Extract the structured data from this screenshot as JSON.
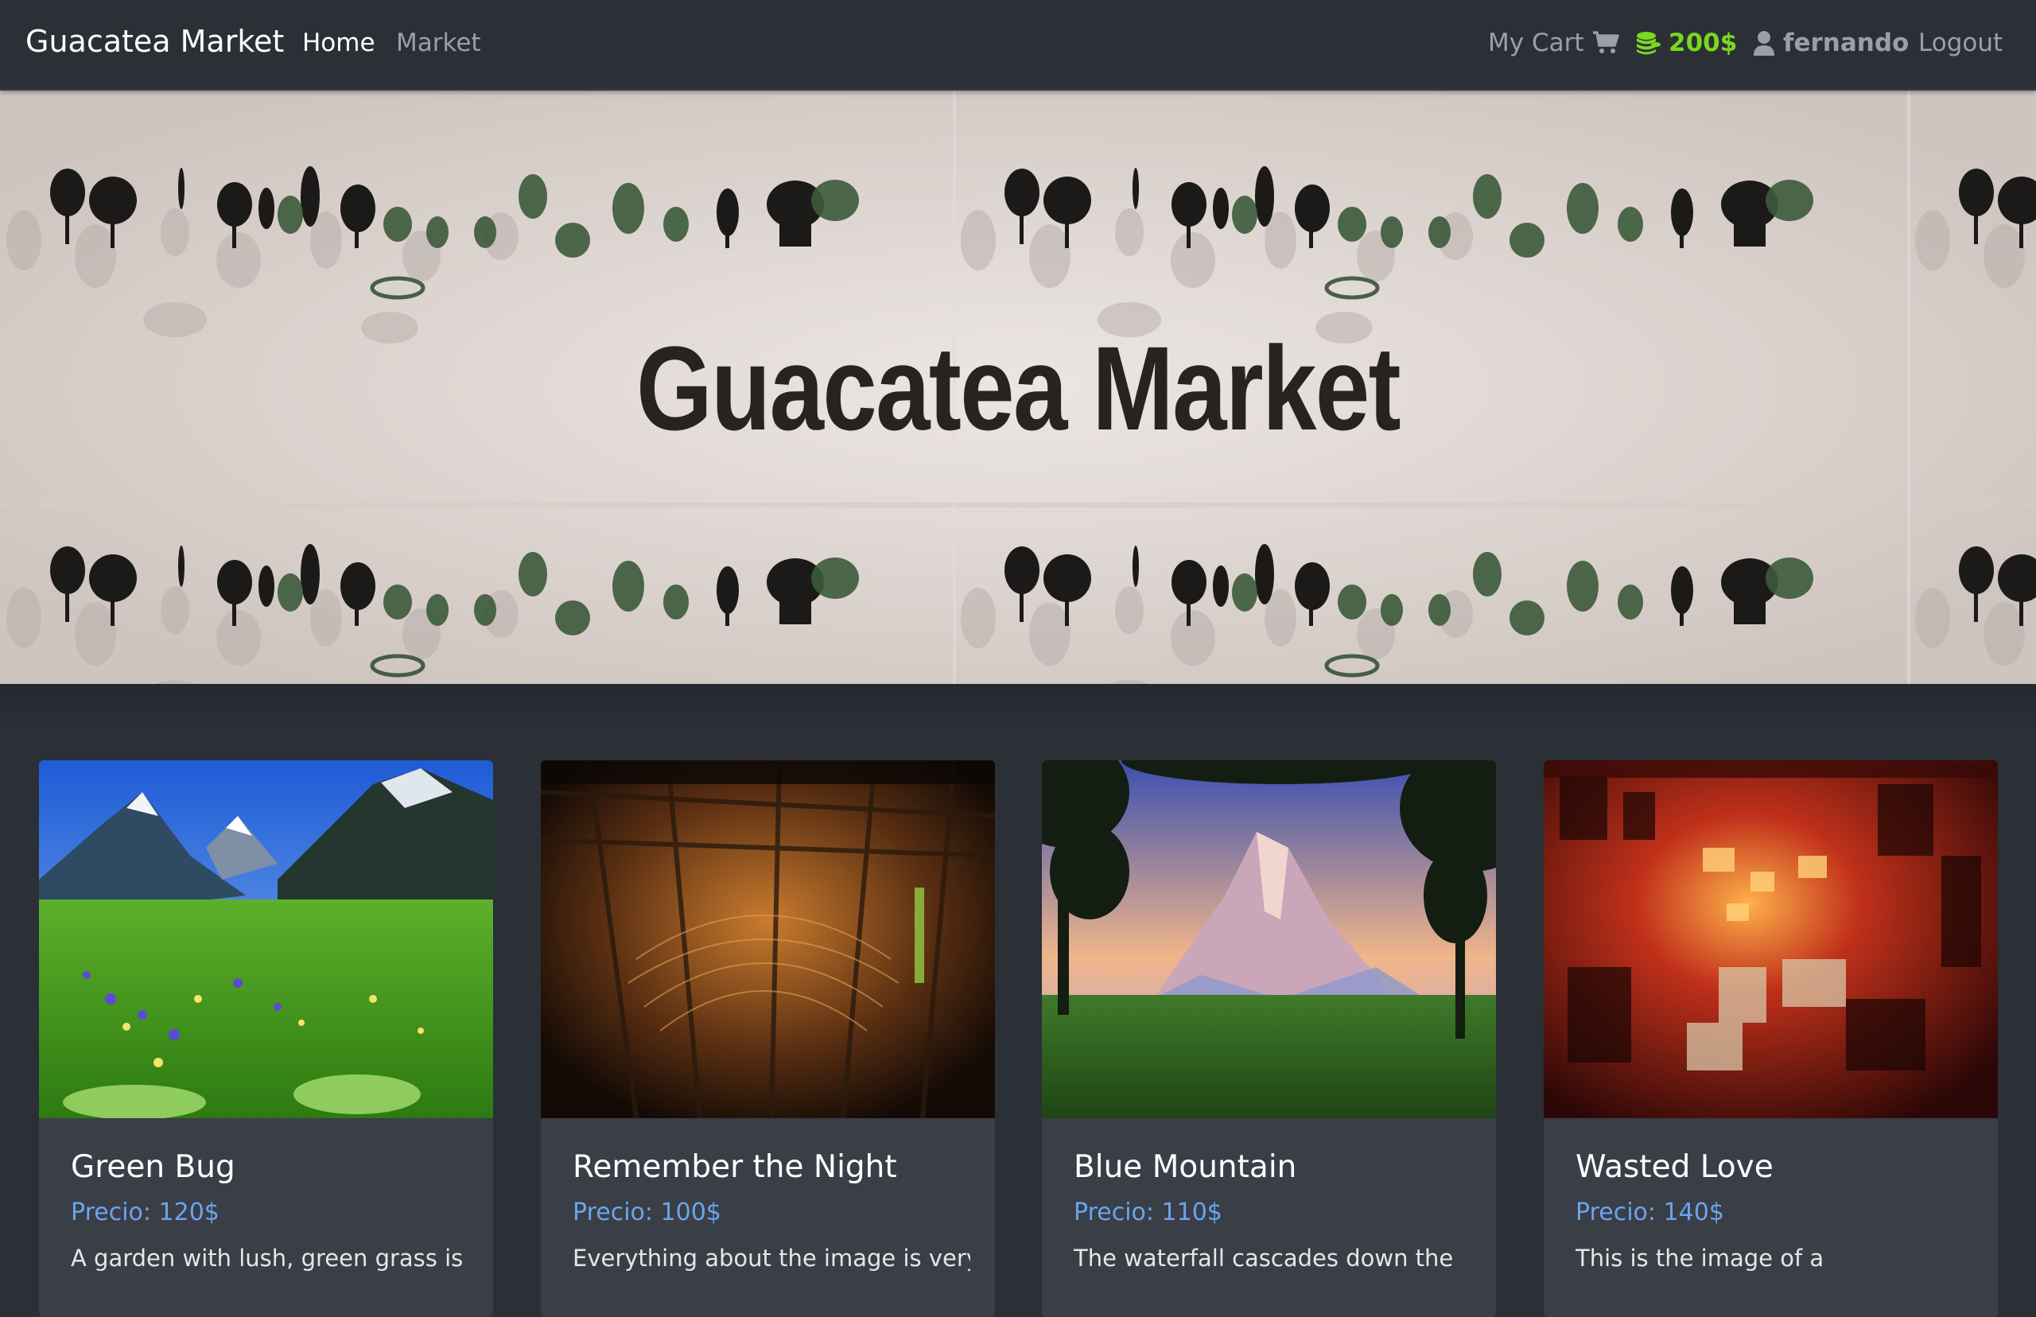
{
  "navbar": {
    "brand": "Guacatea Market",
    "links": {
      "home": "Home",
      "market": "Market"
    },
    "cart_label": "My Cart",
    "balance": "200$",
    "username": "fernando",
    "logout": "Logout",
    "icons": {
      "cart": "cart-icon",
      "coins": "coins-icon",
      "user": "user-icon"
    },
    "colors": {
      "balance": "#7bd81f"
    }
  },
  "hero": {
    "title": "Guacatea Market"
  },
  "products": [
    {
      "title": "Green Bug",
      "price": "Precio: 120$",
      "description": "A garden with lush, green grass is"
    },
    {
      "title": "Remember the Night",
      "price": "Precio: 100$",
      "description": "Everything about the image is very"
    },
    {
      "title": "Blue Mountain",
      "price": "Precio: 110$",
      "description": "The waterfall cascades down the"
    },
    {
      "title": "Wasted Love",
      "price": "Precio: 140$",
      "description": "This is the image of a"
    }
  ],
  "colors": {
    "price": "#6aa5ec",
    "card_bg": "#3a3e46",
    "page_bg": "#2b2f36"
  }
}
